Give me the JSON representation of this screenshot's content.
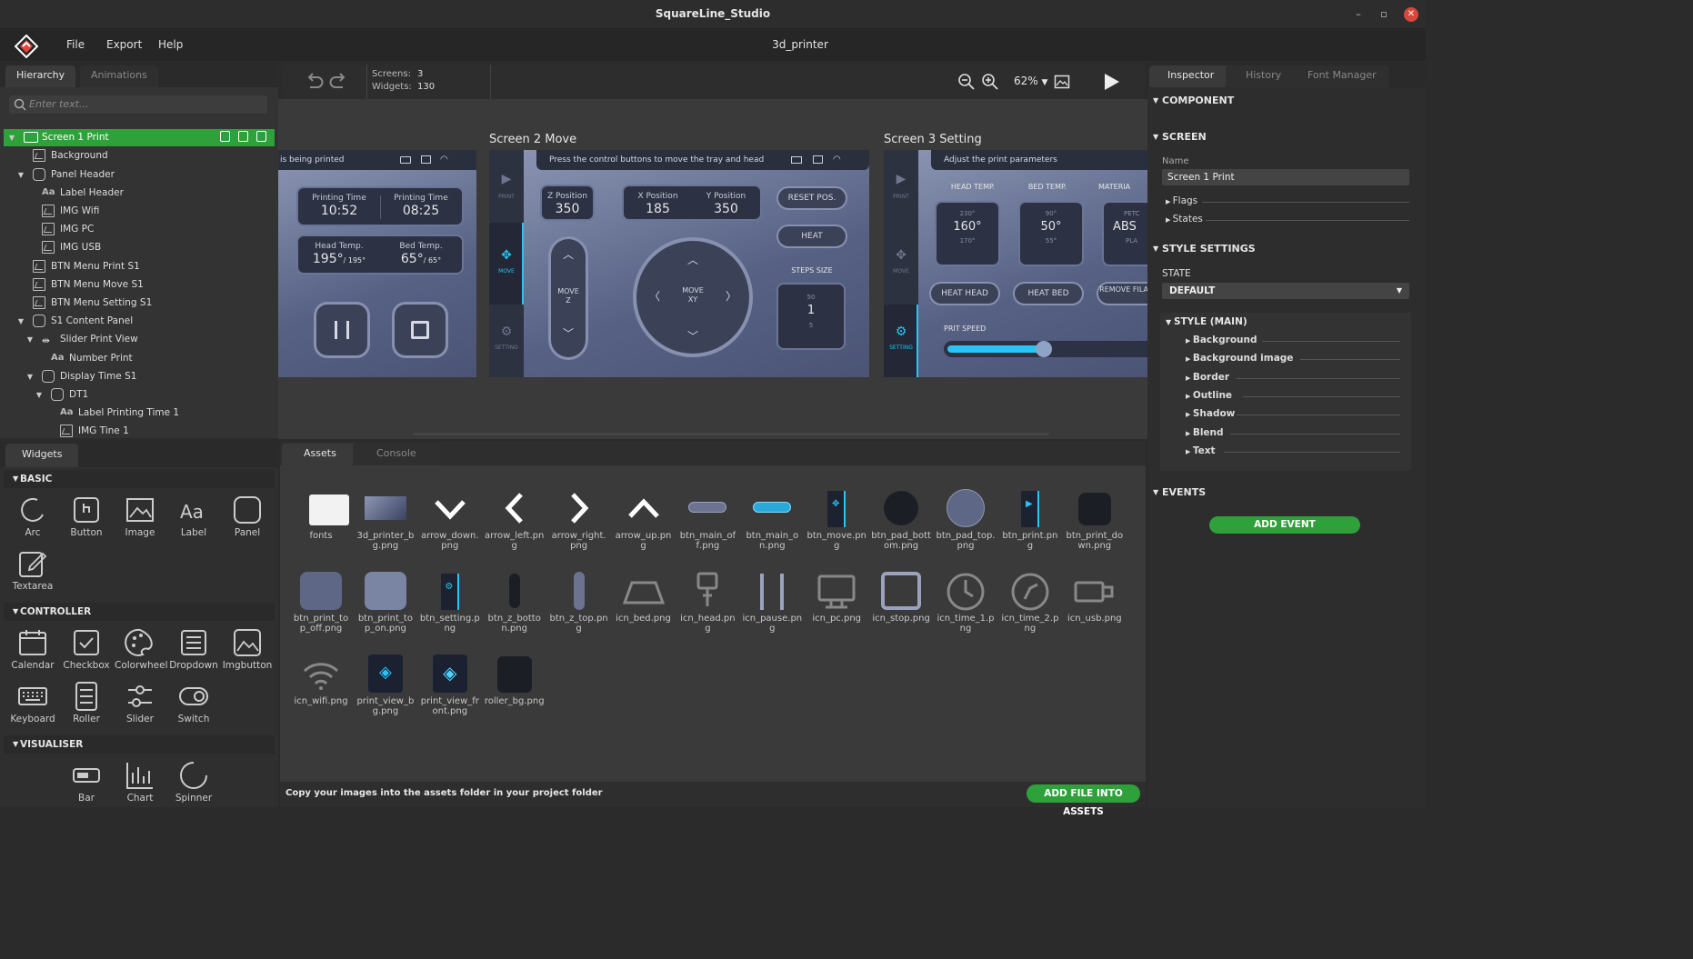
{
  "window": {
    "title": "SquareLine_Studio",
    "minimize": "–",
    "maximize": "▫",
    "close": "✕"
  },
  "menu": {
    "file": "File",
    "export": "Export",
    "help": "Help",
    "project": "3d_printer"
  },
  "hierarchy": {
    "tabs": [
      "Hierarchy",
      "Animations"
    ],
    "search_placeholder": "Enter text...",
    "items": [
      {
        "label": "Screen 1 Print",
        "icon": "screen-icon"
      },
      {
        "label": "Background",
        "icon": "image-icon"
      },
      {
        "label": "Panel Header",
        "icon": "panel-icon"
      },
      {
        "label": "Label Header",
        "icon": "label-icon"
      },
      {
        "label": "IMG Wifi",
        "icon": "image-icon"
      },
      {
        "label": "IMG PC",
        "icon": "image-icon"
      },
      {
        "label": "IMG USB",
        "icon": "image-icon"
      },
      {
        "label": "BTN Menu Print S1",
        "icon": "image-icon"
      },
      {
        "label": "BTN Menu Move S1",
        "icon": "image-icon"
      },
      {
        "label": "BTN Menu Setting S1",
        "icon": "image-icon"
      },
      {
        "label": "S1 Content Panel",
        "icon": "panel-icon"
      },
      {
        "label": "Slider Print View",
        "icon": "slider-icon"
      },
      {
        "label": "Number Print",
        "icon": "label-icon"
      },
      {
        "label": "Display Time S1",
        "icon": "panel-icon"
      },
      {
        "label": "DT1",
        "icon": "panel-icon"
      },
      {
        "label": "Label Printing Time 1",
        "icon": "label-icon"
      },
      {
        "label": "IMG Tine 1",
        "icon": "image-icon"
      }
    ]
  },
  "widgets": {
    "tab": "Widgets",
    "basic": {
      "title": "BASIC",
      "items": [
        "Arc",
        "Button",
        "Image",
        "Label",
        "Panel",
        "Textarea"
      ]
    },
    "controller": {
      "title": "CONTROLLER",
      "items": [
        "Calendar",
        "Checkbox",
        "Colorwheel",
        "Dropdown",
        "Imgbutton",
        "Keyboard",
        "Roller",
        "Slider",
        "Switch"
      ]
    },
    "visualiser": {
      "title": "VISUALISER",
      "items": [
        "Bar",
        "Chart",
        "Spinner"
      ]
    }
  },
  "toolbar": {
    "screens_label": "Screens:",
    "screens_value": "3",
    "widgets_label": "Widgets:",
    "widgets_value": "130",
    "zoom": "62%"
  },
  "canvas": {
    "screen2": "Screen 2 Move",
    "screen3": "Screen 3 Setting",
    "s1": {
      "header": "is being printed",
      "pt1_title": "Printing Time",
      "pt1_value": "10:52",
      "pt2_title": "Printing Time",
      "pt2_value": "08:25",
      "head_title": "Head Temp.",
      "head_value": "195°",
      "head_max": "/ 195°",
      "bed_title": "Bed Temp.",
      "bed_value": "65°",
      "bed_max": "/ 65°"
    },
    "s2": {
      "header": "Press the control buttons to move the tray and head",
      "side_print": "PRINT",
      "side_move": "MOVE",
      "side_setting": "SETTING",
      "z_title": "Z Position",
      "z_value": "350",
      "x_title": "X Position",
      "x_value": "185",
      "y_title": "Y Position",
      "y_value": "350",
      "reset": "RESET POS.",
      "heat": "HEAT",
      "steps": "STEPS SIZE",
      "step_top": "50",
      "step_mid": "1",
      "step_bot": "5",
      "movez": "MOVE\nZ",
      "movexy": "MOVE\nXY"
    },
    "s3": {
      "header": "Adjust the print parameters",
      "side_print": "PRINT",
      "side_move": "MOVE",
      "side_setting": "SETTING",
      "head": "HEAD TEMP.",
      "bed": "BED TEMP.",
      "mat": "MATERIA",
      "h_top": "230°",
      "h_mid": "160°",
      "h_bot": "170°",
      "b_top": "90°",
      "b_mid": "50°",
      "b_bot": "55°",
      "m_top": "PETC",
      "m_mid": "ABS",
      "m_bot": "PLA",
      "heat_head": "HEAT HEAD",
      "heat_bed": "HEAT BED",
      "remove": "REMOVE FILAMEN",
      "speed": "PRIT SPEED",
      "speed_level": 0.46
    }
  },
  "assets": {
    "tabs": [
      "Assets",
      "Console"
    ],
    "files": [
      "fonts",
      "3d_printer_bg.png",
      "arrow_down.png",
      "arrow_left.png",
      "arrow_right.png",
      "arrow_up.png",
      "btn_main_off.png",
      "btn_main_on.png",
      "btn_move.png",
      "btn_pad_bottom.png",
      "btn_pad_top.png",
      "btn_print.png",
      "btn_print_down.png",
      "btn_print_top_off.png",
      "btn_print_top_on.png",
      "btn_setting.png",
      "btn_z_botton.png",
      "btn_z_top.png",
      "icn_bed.png",
      "icn_head.png",
      "icn_pause.png",
      "icn_pc.png",
      "icn_stop.png",
      "icn_time_1.png",
      "icn_time_2.png",
      "icn_usb.png",
      "icn_wifi.png",
      "print_view_bg.png",
      "print_view_front.png",
      "roller_bg.png"
    ],
    "footer": "Copy your images into the assets folder in your project folder",
    "add_file": "ADD FILE INTO ASSETS"
  },
  "inspector": {
    "tabs": [
      "Inspector",
      "History",
      "Font Manager"
    ],
    "component": "COMPONENT",
    "screen": "SCREEN",
    "name_label": "Name",
    "name_value": "Screen 1 Print",
    "flags": "Flags",
    "states": "States",
    "style_settings": "STYLE SETTINGS",
    "state_label": "STATE",
    "state_value": "DEFAULT",
    "style_main": "STYLE (MAIN)",
    "style_items": [
      "Background",
      "Background image",
      "Border",
      "Outline",
      "Shadow",
      "Blend",
      "Text"
    ],
    "events": "EVENTS",
    "add_event": "ADD EVENT"
  },
  "colors": {
    "accent_green": "#2ea13b",
    "accent_cyan": "#27c4f5",
    "panel_bg": "#333333"
  }
}
